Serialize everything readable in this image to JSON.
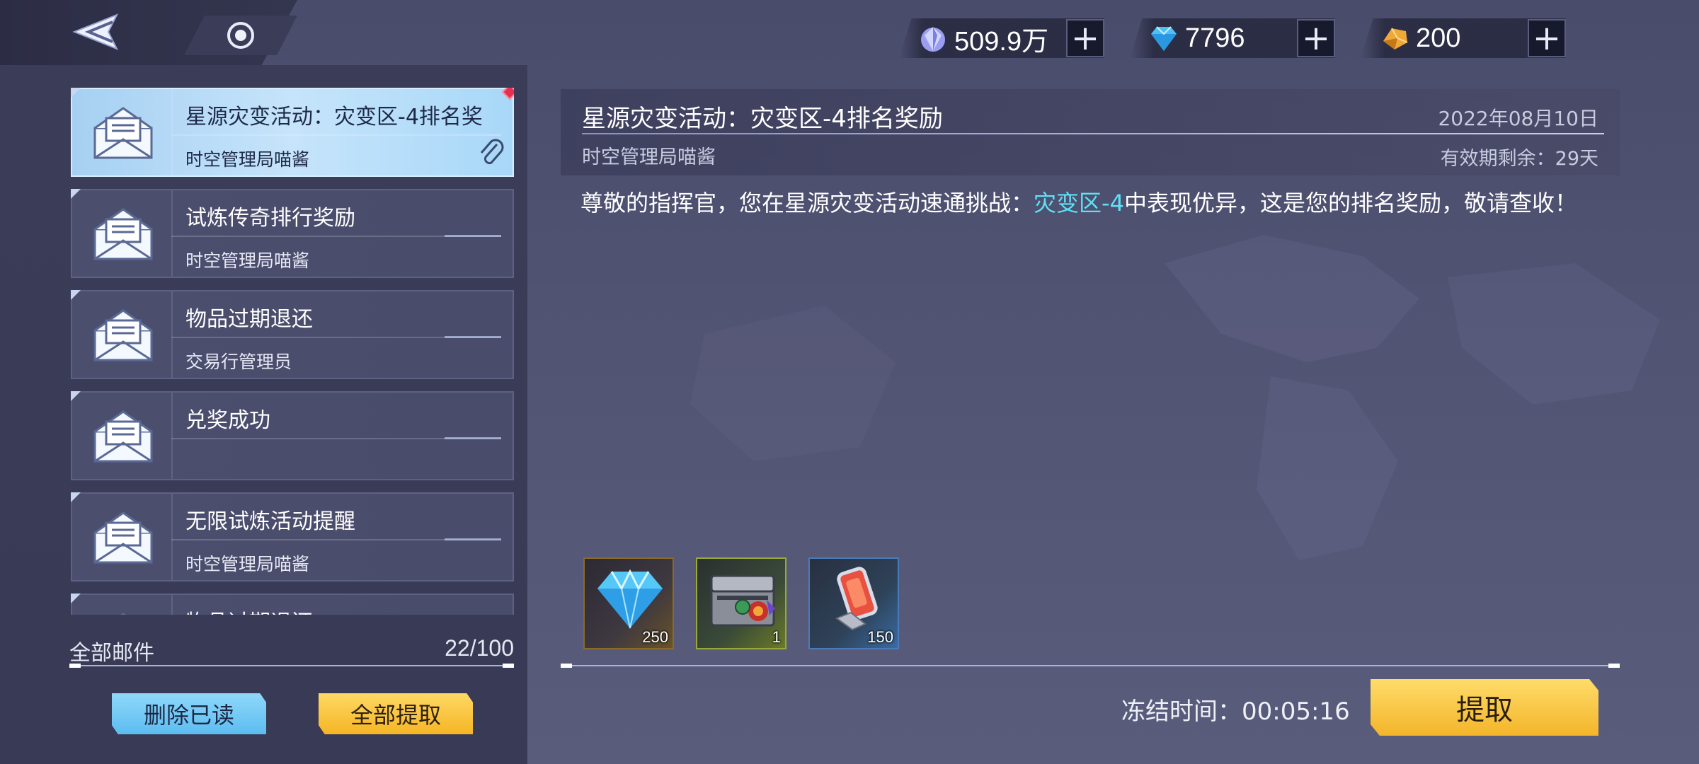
{
  "currencies": [
    {
      "icon": "crystal-icon",
      "value": "509.9万"
    },
    {
      "icon": "diamond-icon",
      "value": "7796"
    },
    {
      "icon": "gold-gem-icon",
      "value": "200"
    }
  ],
  "mail_list": [
    {
      "title": "星源灾变活动：灾变区-4排名奖",
      "sender": "时空管理局喵酱",
      "active": true,
      "attachment": true,
      "unread": true
    },
    {
      "title": "试炼传奇排行奖励",
      "sender": "时空管理局喵酱"
    },
    {
      "title": "物品过期退还",
      "sender": "交易行管理员"
    },
    {
      "title": "兑奖成功",
      "sender": ""
    },
    {
      "title": "无限试炼活动提醒",
      "sender": "时空管理局喵酱"
    },
    {
      "title": "物品过期退还",
      "sender": ""
    }
  ],
  "mail_count": {
    "label": "全部邮件",
    "value": "22/100"
  },
  "buttons": {
    "delete_read": "删除已读",
    "claim_all": "全部提取",
    "claim": "提取"
  },
  "detail": {
    "title": "星源灾变活动：灾变区-4排名奖励",
    "date": "2022年08月10日",
    "sender": "时空管理局喵酱",
    "expire": "有效期剩余：29天",
    "body_pre": "尊敬的指挥官，您在星源灾变活动速通挑战：",
    "body_highlight": "灾变区-4",
    "body_post": "中表现优异，这是您的排名奖励，敬请查收！"
  },
  "rewards": [
    {
      "icon": "diamond-icon",
      "qty": "250"
    },
    {
      "icon": "treasure-chest-icon",
      "qty": "1"
    },
    {
      "icon": "energy-capsule-icon",
      "qty": "150"
    }
  ],
  "freeze_time": "冻结时间：00:05:16",
  "colors": {
    "highlight": "#5fe0f5",
    "active_mail": "#b4dcf6",
    "gold_button": "#f5b524",
    "blue_button": "#5cbdf0"
  }
}
